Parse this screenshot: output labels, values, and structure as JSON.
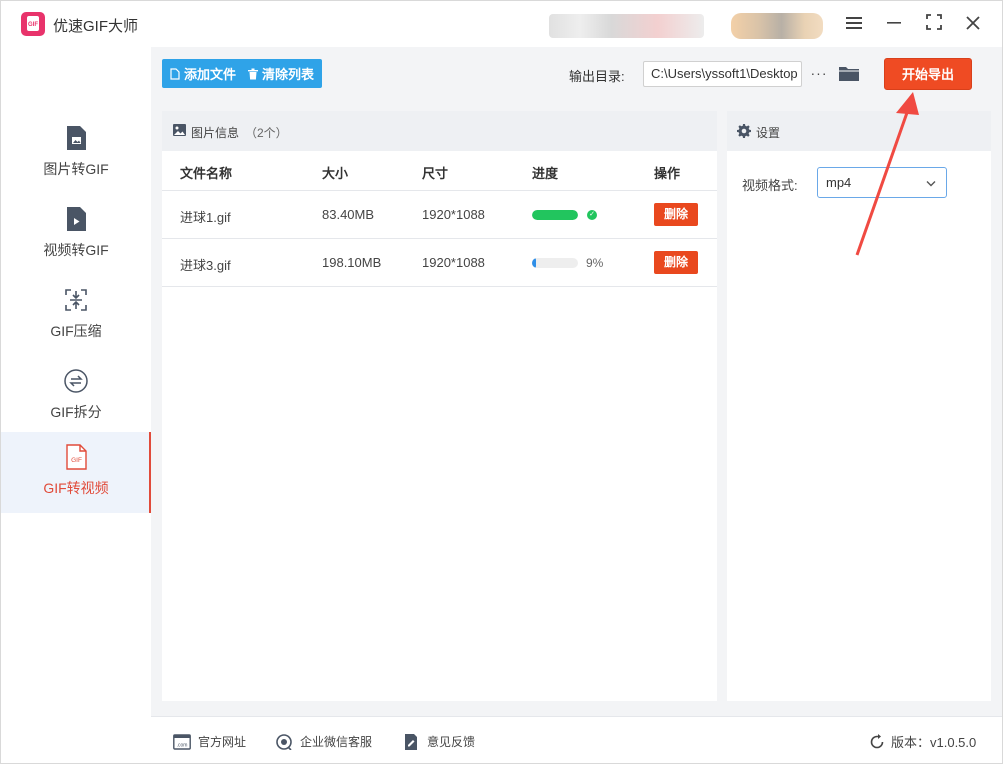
{
  "app": {
    "title": "优速GIF大师",
    "logo_text": "GIF"
  },
  "sidebar": {
    "items": [
      {
        "label": "图片转GIF",
        "icon": "image-file-icon"
      },
      {
        "label": "视频转GIF",
        "icon": "video-file-icon"
      },
      {
        "label": "GIF压缩",
        "icon": "compress-icon"
      },
      {
        "label": "GIF拆分",
        "icon": "split-icon"
      },
      {
        "label": "GIF转视频",
        "icon": "gif-file-icon",
        "active": true
      }
    ]
  },
  "toolbar": {
    "add_label": "添加文件",
    "clear_label": "清除列表",
    "output_label": "输出目录:",
    "output_path": "C:\\Users\\yssoft1\\Desktop",
    "more_label": "···",
    "export_label": "开始导出"
  },
  "file_panel": {
    "title": "图片信息",
    "count": "（2个）",
    "columns": [
      "文件名称",
      "大小",
      "尺寸",
      "进度",
      "操作"
    ],
    "rows": [
      {
        "name": "进球1.gif",
        "size": "83.40MB",
        "dims": "1920*1088",
        "progress": 1.0,
        "status": "done",
        "action": "删除"
      },
      {
        "name": "进球3.gif",
        "size": "198.10MB",
        "dims": "1920*1088",
        "progress": 0.09,
        "pct_text": "9%",
        "action": "删除"
      }
    ]
  },
  "settings": {
    "title": "设置",
    "format_label": "视频格式:",
    "format_value": "mp4"
  },
  "footer": {
    "links": [
      "官方网址",
      "企业微信客服",
      "意见反馈"
    ],
    "version": "版本：v1.0.5.0"
  },
  "colors": {
    "accent_blue": "#2fa3e8",
    "export_red": "#ef4b23",
    "active_red": "#e14b3a",
    "progress_green": "#22c55e",
    "progress_blue": "#2f8fe8"
  }
}
